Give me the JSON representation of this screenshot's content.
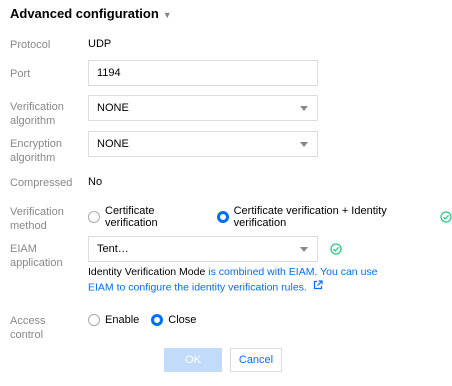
{
  "section": {
    "title": "Advanced configuration"
  },
  "protocol": {
    "label": "Protocol",
    "value": "UDP"
  },
  "port": {
    "label": "Port",
    "value": "1194"
  },
  "verification_algorithm": {
    "label": "Verification algorithm",
    "value": "NONE"
  },
  "encryption_algorithm": {
    "label": "Encryption algorithm",
    "value": "NONE"
  },
  "compressed": {
    "label": "Compressed",
    "value": "No"
  },
  "verification_method": {
    "label": "Verification method",
    "options": [
      "Certificate verification",
      "Certificate verification + Identity verification"
    ],
    "selected": 1
  },
  "eiam": {
    "label": "EIAM application",
    "value": "Tent…",
    "help_prefix": "Identity Verification Mode ",
    "help_link": "is combined with EIAM. You can use EIAM to configure the identity verification rules."
  },
  "access_control": {
    "label": "Access control",
    "options": [
      "Enable",
      "Close"
    ],
    "selected": 1
  },
  "buttons": {
    "ok": "OK",
    "cancel": "Cancel"
  },
  "colors": {
    "accent": "#006eff",
    "success": "#29cc85",
    "ok_disabled": "#c3dbfb"
  }
}
